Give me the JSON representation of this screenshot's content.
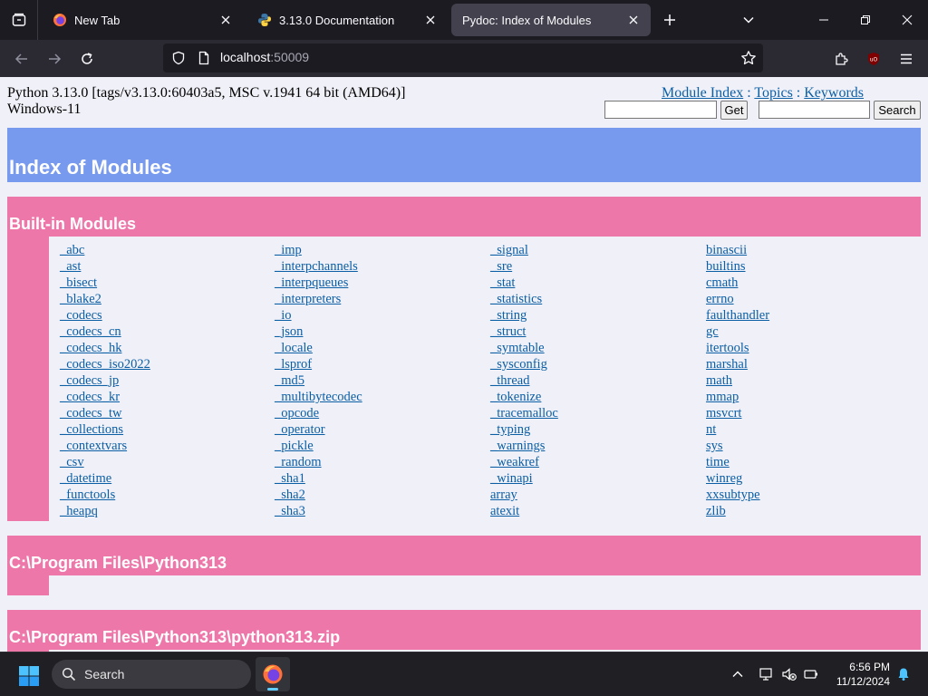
{
  "browser": {
    "tabs": [
      {
        "title": "New Tab",
        "icon": "firefox-icon",
        "active": false
      },
      {
        "title": "3.13.0 Documentation",
        "icon": "python-icon",
        "active": false
      },
      {
        "title": "Pydoc: Index of Modules",
        "icon": "",
        "active": true
      }
    ],
    "url_host": "localhost",
    "url_port": ":50009"
  },
  "page": {
    "platform_line1": "Python 3.13.0 [tags/v3.13.0:60403a5, MSC v.1941 64 bit (AMD64)]",
    "platform_line2": "Windows-11",
    "links": {
      "module_index": "Module Index",
      "topics": "Topics",
      "keywords": "Keywords",
      "separator": " : "
    },
    "get_button": "Get",
    "search_button": "Search",
    "title": "Index of Modules",
    "sections": {
      "builtin": "Built-in Modules",
      "program_files": "C:\\Program Files\\Python313",
      "python_zip": "C:\\Program Files\\Python313\\python313.zip"
    },
    "builtin_columns": [
      [
        "_abc",
        "_ast",
        "_bisect",
        "_blake2",
        "_codecs",
        "_codecs_cn",
        "_codecs_hk",
        "_codecs_iso2022",
        "_codecs_jp",
        "_codecs_kr",
        "_codecs_tw",
        "_collections",
        "_contextvars",
        "_csv",
        "_datetime",
        "_functools",
        "_heapq"
      ],
      [
        "_imp",
        "_interpchannels",
        "_interpqueues",
        "_interpreters",
        "_io",
        "_json",
        "_locale",
        "_lsprof",
        "_md5",
        "_multibytecodec",
        "_opcode",
        "_operator",
        "_pickle",
        "_random",
        "_sha1",
        "_sha2",
        "_sha3"
      ],
      [
        "_signal",
        "_sre",
        "_stat",
        "_statistics",
        "_string",
        "_struct",
        "_symtable",
        "_sysconfig",
        "_thread",
        "_tokenize",
        "_tracemalloc",
        "_typing",
        "_warnings",
        "_weakref",
        "_winapi",
        "array",
        "atexit"
      ],
      [
        "binascii",
        "builtins",
        "cmath",
        "errno",
        "faulthandler",
        "gc",
        "itertools",
        "marshal",
        "math",
        "mmap",
        "msvcrt",
        "nt",
        "sys",
        "time",
        "winreg",
        "xxsubtype",
        "zlib"
      ]
    ]
  },
  "taskbar": {
    "search_label": "Search",
    "time": "6:56 PM",
    "date": "11/12/2024"
  },
  "colors": {
    "heading_blue": "#7799ee",
    "section_pink": "#ee77aa",
    "link": "#0b5fa5"
  }
}
